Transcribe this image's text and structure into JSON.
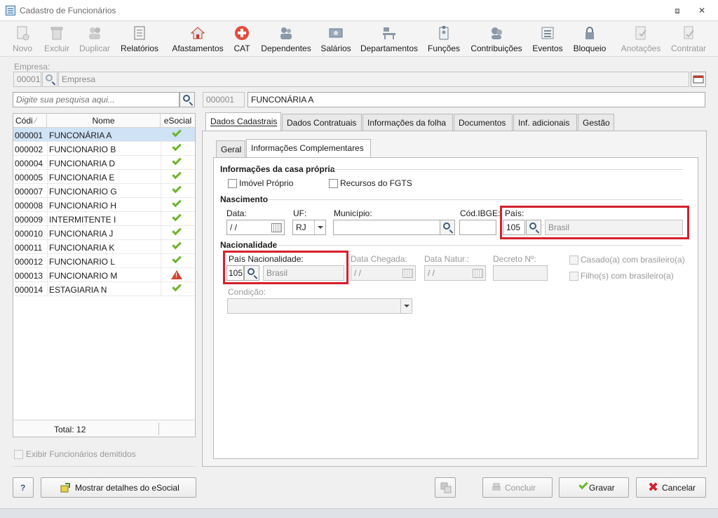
{
  "window": {
    "title": "Cadastro de Funcionários"
  },
  "toolbar": {
    "items": [
      {
        "label": "Novo",
        "enabled": false
      },
      {
        "label": "Excluir",
        "enabled": false
      },
      {
        "label": "Duplicar",
        "enabled": false
      },
      {
        "label": "Relatórios",
        "enabled": true
      },
      {
        "label": "Afastamentos",
        "enabled": true
      },
      {
        "label": "CAT",
        "enabled": true
      },
      {
        "label": "Dependentes",
        "enabled": true
      },
      {
        "label": "Salários",
        "enabled": true
      },
      {
        "label": "Departamentos",
        "enabled": true
      },
      {
        "label": "Funções",
        "enabled": true
      },
      {
        "label": "Contribuições",
        "enabled": true
      },
      {
        "label": "Eventos",
        "enabled": true
      },
      {
        "label": "Bloqueio",
        "enabled": true
      },
      {
        "label": "Anotações",
        "enabled": false
      },
      {
        "label": "Contratar",
        "enabled": false
      }
    ]
  },
  "empresa": {
    "label": "Empresa:",
    "code": "00001",
    "name_placeholder": "Empresa"
  },
  "search": {
    "placeholder": "Digite sua pesquisa aqui..."
  },
  "employee_header": {
    "code": "000001",
    "name": "FUNCONÁRIA A"
  },
  "list": {
    "columns": [
      "Códi",
      "Nome",
      "eSocial"
    ],
    "rows": [
      {
        "code": "000001",
        "name": "FUNCONÁRIA A",
        "status": "ok",
        "selected": true
      },
      {
        "code": "000002",
        "name": "FUNCIONARIO B",
        "status": "ok"
      },
      {
        "code": "000004",
        "name": "FUNCIONARIA D",
        "status": "ok"
      },
      {
        "code": "000005",
        "name": "FUNCIONARIA E",
        "status": "ok"
      },
      {
        "code": "000007",
        "name": "FUNCIONARIO G",
        "status": "ok"
      },
      {
        "code": "000008",
        "name": "FUNCIONARIO H",
        "status": "ok"
      },
      {
        "code": "000009",
        "name": "INTERMITENTE I",
        "status": "ok"
      },
      {
        "code": "000010",
        "name": "FUNCIONARIA J",
        "status": "ok"
      },
      {
        "code": "000011",
        "name": "FUNCIONARIA K",
        "status": "ok"
      },
      {
        "code": "000012",
        "name": "FUNCIONARIO L",
        "status": "ok"
      },
      {
        "code": "000013",
        "name": "FUNCIONARIO M",
        "status": "warning"
      },
      {
        "code": "000014",
        "name": "ESTAGIARIA N",
        "status": "ok"
      }
    ],
    "total": "Total: 12"
  },
  "show_dismissed": "Exibir Funcionários demitidos",
  "tabs": [
    "Dados Cadastrais",
    "Dados Contratuais",
    "Informações da folha",
    "Documentos",
    "Inf. adicionais",
    "Gestão"
  ],
  "subtabs": [
    "Geral",
    "Informações Complementares"
  ],
  "casa_propria": {
    "title": "Informações da casa própria",
    "imovel": "Imóvel Próprio",
    "fgts": "Recursos do FGTS"
  },
  "nascimento": {
    "title": "Nascimento",
    "data_label": "Data:",
    "data_value": " / /",
    "uf_label": "UF:",
    "uf_value": "RJ",
    "municipio_label": "Município:",
    "ibge_label": "Cód.IBGE:",
    "pais_label": "País:",
    "pais_code": "105",
    "pais_name": "Brasil"
  },
  "nacionalidade": {
    "title": "Nacionalidade",
    "pais_label": "País Nacionalidade:",
    "pais_code": "105",
    "pais_name": "Brasil",
    "chegada_label": "Data Chegada:",
    "chegada_value": " / /",
    "natur_label": "Data Natur.:",
    "natur_value": " / /",
    "decreto_label": "Decreto Nº:",
    "casado": "Casado(a) com brasileiro(a)",
    "filho": "Filho(s) com brasileiro(a)",
    "condicao_label": "Condição:"
  },
  "footer": {
    "help": "?",
    "esocial": "Mostrar detalhes do eSocial",
    "concluir": "Concluir",
    "gravar": "Gravar",
    "cancelar": "Cancelar"
  }
}
